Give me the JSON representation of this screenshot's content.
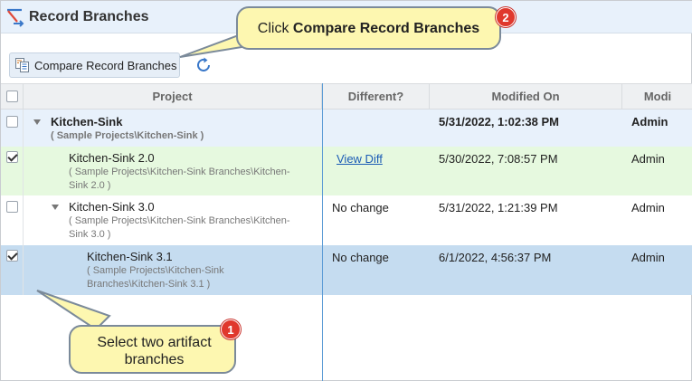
{
  "title": "Record Branches",
  "toolbar": {
    "compare_label": "Compare Record Branches",
    "refresh_icon": "refresh-icon"
  },
  "columns": [
    "Project",
    "Different?",
    "Modified On",
    "Modi"
  ],
  "rows": [
    {
      "name": "Kitchen-Sink",
      "path": "( Sample Projects\\Kitchen-Sink )",
      "different": "",
      "modified_on": "5/31/2022, 1:02:38 PM",
      "modified_by": "Admin",
      "checked": false
    },
    {
      "name": "Kitchen-Sink 2.0",
      "path": "( Sample Projects\\Kitchen-Sink Branches\\Kitchen-Sink 2.0 )",
      "different": "View Diff",
      "modified_on": "5/30/2022, 7:08:57 PM",
      "modified_by": "Admin",
      "checked": true
    },
    {
      "name": "Kitchen-Sink 3.0",
      "path": "( Sample Projects\\Kitchen-Sink Branches\\Kitchen-Sink 3.0 )",
      "different": "No change",
      "modified_on": "5/31/2022, 1:21:39 PM",
      "modified_by": "Admin",
      "checked": false
    },
    {
      "name": "Kitchen-Sink 3.1",
      "path": "( Sample Projects\\Kitchen-Sink Branches\\Kitchen-Sink 3.1 )",
      "different": "No change",
      "modified_on": "6/1/2022, 4:56:37 PM",
      "modified_by": "Admin",
      "checked": true
    }
  ],
  "callouts": {
    "top": {
      "prefix": "Click ",
      "bold": "Compare Record Branches",
      "badge": "2"
    },
    "bottom": {
      "text": "Select two artifact branches",
      "badge": "1"
    }
  },
  "colors": {
    "row_group": "#e8f1fb",
    "row_green": "#e6f9df",
    "row_selected": "#c5dcf0",
    "callout_fill": "#fdf7b0",
    "badge": "#e0382d",
    "link": "#1a5bb5"
  }
}
